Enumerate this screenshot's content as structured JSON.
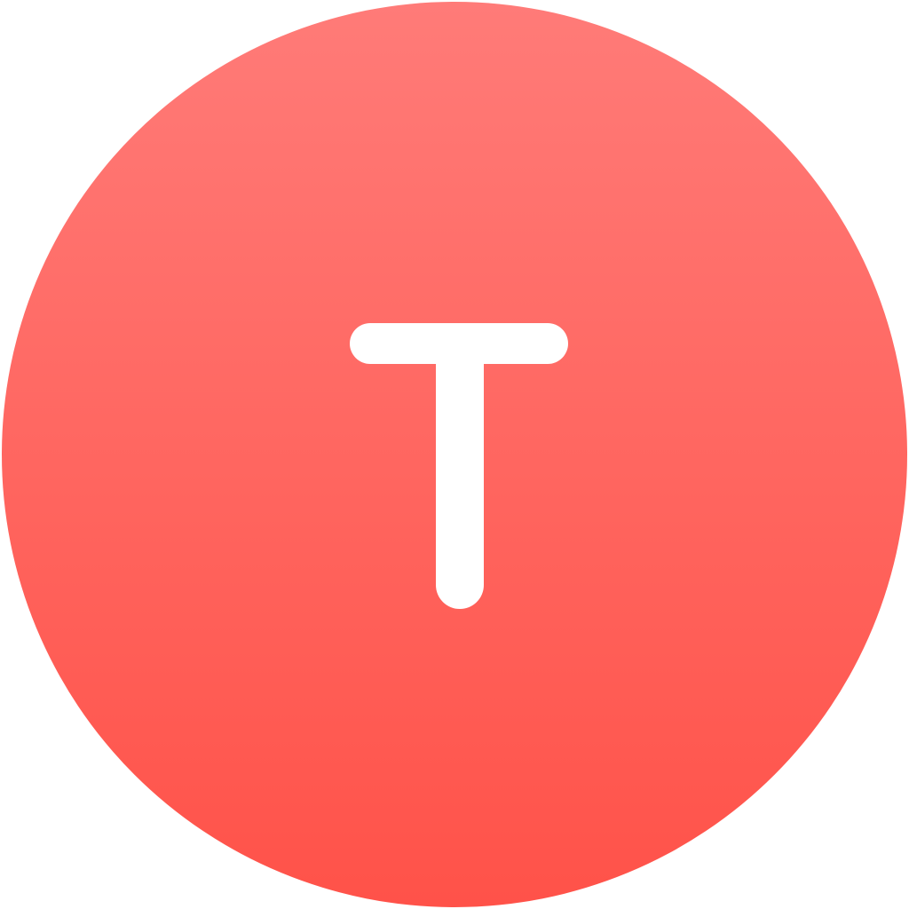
{
  "icon": {
    "name": "letter-t-avatar",
    "letter": "T",
    "colors": {
      "gradient_top": "#FF7B78",
      "gradient_bottom": "#FF5249",
      "glyph": "#FFFFFF",
      "background": "#FFFFFF"
    }
  }
}
